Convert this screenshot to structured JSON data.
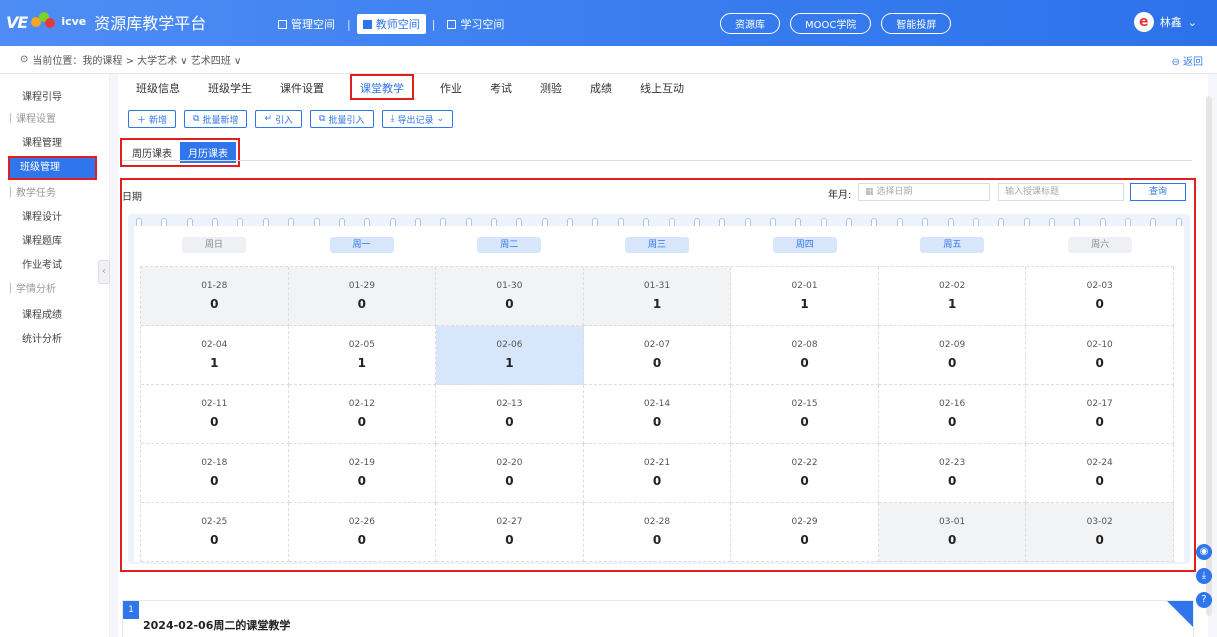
{
  "brand": {
    "ve": "VE",
    "icve": "icve",
    "title": "资源库教学平台",
    "colors": {
      "primary": "#2f75eb",
      "highlight": "#e02020"
    }
  },
  "spaces": [
    {
      "label": "管理空间",
      "active": false
    },
    {
      "label": "教师空间",
      "active": true
    },
    {
      "label": "学习空间",
      "active": false
    }
  ],
  "pills": [
    "资源库",
    "MOOC学院",
    "智能投屏"
  ],
  "user": {
    "name": "林鑫",
    "avatar": "e"
  },
  "breadcrumb": {
    "text": "当前位置：我的课程 > 大学艺术 ∨ 艺术四班 ∨",
    "back": "返回"
  },
  "sidebar": {
    "items": [
      {
        "label": "课程引导",
        "group": false
      },
      {
        "label": "课程设置",
        "group": true
      },
      {
        "label": "课程管理",
        "group": false
      },
      {
        "label": "班级管理",
        "group": false,
        "active": true
      },
      {
        "label": "教学任务",
        "group": true
      },
      {
        "label": "课程设计",
        "group": false
      },
      {
        "label": "课程题库",
        "group": false
      },
      {
        "label": "作业考试",
        "group": false
      },
      {
        "label": "学情分析",
        "group": true
      },
      {
        "label": "课程成绩",
        "group": false
      },
      {
        "label": "统计分析",
        "group": false
      }
    ]
  },
  "tabs": [
    "班级信息",
    "班级学生",
    "课件设置",
    "课堂教学",
    "作业",
    "考试",
    "测验",
    "成绩",
    "线上互动"
  ],
  "active_tab": "课堂教学",
  "toolbar": {
    "add": "新增",
    "batch_add": "批量新增",
    "import": "引入",
    "batch_import": "批量引入",
    "export": "导出记录"
  },
  "views": {
    "week": "周历课表",
    "month": "月历课表"
  },
  "calendar": {
    "label": "日期",
    "year_month_label": "年月:",
    "date_placeholder": "选择日期",
    "title_placeholder": "输入授课标题",
    "query": "查询",
    "weekdays": [
      "周日",
      "周一",
      "周二",
      "周三",
      "周四",
      "周五",
      "周六"
    ],
    "weeks": [
      [
        {
          "d": "01-28",
          "n": "0",
          "grey": true
        },
        {
          "d": "01-29",
          "n": "0",
          "grey": true
        },
        {
          "d": "01-30",
          "n": "0",
          "grey": true
        },
        {
          "d": "01-31",
          "n": "1",
          "grey": true
        },
        {
          "d": "02-01",
          "n": "1"
        },
        {
          "d": "02-02",
          "n": "1"
        },
        {
          "d": "02-03",
          "n": "0"
        }
      ],
      [
        {
          "d": "02-04",
          "n": "1"
        },
        {
          "d": "02-05",
          "n": "1"
        },
        {
          "d": "02-06",
          "n": "1",
          "sel": true
        },
        {
          "d": "02-07",
          "n": "0"
        },
        {
          "d": "02-08",
          "n": "0"
        },
        {
          "d": "02-09",
          "n": "0"
        },
        {
          "d": "02-10",
          "n": "0"
        }
      ],
      [
        {
          "d": "02-11",
          "n": "0"
        },
        {
          "d": "02-12",
          "n": "0"
        },
        {
          "d": "02-13",
          "n": "0"
        },
        {
          "d": "02-14",
          "n": "0"
        },
        {
          "d": "02-15",
          "n": "0"
        },
        {
          "d": "02-16",
          "n": "0"
        },
        {
          "d": "02-17",
          "n": "0"
        }
      ],
      [
        {
          "d": "02-18",
          "n": "0"
        },
        {
          "d": "02-19",
          "n": "0"
        },
        {
          "d": "02-20",
          "n": "0"
        },
        {
          "d": "02-21",
          "n": "0"
        },
        {
          "d": "02-22",
          "n": "0"
        },
        {
          "d": "02-23",
          "n": "0"
        },
        {
          "d": "02-24",
          "n": "0"
        }
      ],
      [
        {
          "d": "02-25",
          "n": "0"
        },
        {
          "d": "02-26",
          "n": "0"
        },
        {
          "d": "02-27",
          "n": "0"
        },
        {
          "d": "02-28",
          "n": "0"
        },
        {
          "d": "02-29",
          "n": "0"
        },
        {
          "d": "03-01",
          "n": "0",
          "grey": true
        },
        {
          "d": "03-02",
          "n": "0",
          "grey": true
        }
      ]
    ]
  },
  "lesson": {
    "index": "1",
    "title": "2024-02-06周二的课堂教学"
  }
}
